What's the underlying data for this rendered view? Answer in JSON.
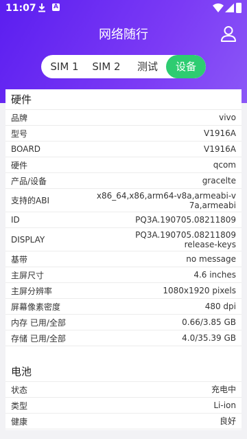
{
  "status": {
    "time": "11:07",
    "a_badge": "A"
  },
  "appbar": {
    "title": "网络随行"
  },
  "tabs": [
    "SIM 1",
    "SIM 2",
    "测试",
    "设备"
  ],
  "hardware": {
    "title": "硬件",
    "rows": [
      {
        "k": "品牌",
        "v": "vivo"
      },
      {
        "k": "型号",
        "v": "V1916A"
      },
      {
        "k": "BOARD",
        "v": "V1916A"
      },
      {
        "k": "硬件",
        "v": "qcom"
      },
      {
        "k": "产品/设备",
        "v": "gracelte"
      },
      {
        "k": "支持的ABI",
        "v": "x86_64,x86,arm64-v8a,armeabi-v7a,armeabi"
      },
      {
        "k": "ID",
        "v": "PQ3A.190705.08211809"
      },
      {
        "k": "DISPLAY",
        "v": "PQ3A.190705.08211809 release-keys"
      },
      {
        "k": "基带",
        "v": "no message"
      },
      {
        "k": "主屏尺寸",
        "v": "4.6 inches"
      },
      {
        "k": "主屏分辨率",
        "v": "1080x1920 pixels"
      },
      {
        "k": "屏幕像素密度",
        "v": "480 dpi"
      },
      {
        "k": "内存 已用/全部",
        "v": "0.66/3.85 GB"
      },
      {
        "k": "存储 已用/全部",
        "v": "4.0/35.39 GB"
      }
    ]
  },
  "battery": {
    "title": "电池",
    "rows": [
      {
        "k": "状态",
        "v": "充电中"
      },
      {
        "k": "类型",
        "v": "Li-ion"
      },
      {
        "k": "健康",
        "v": "良好"
      }
    ]
  }
}
